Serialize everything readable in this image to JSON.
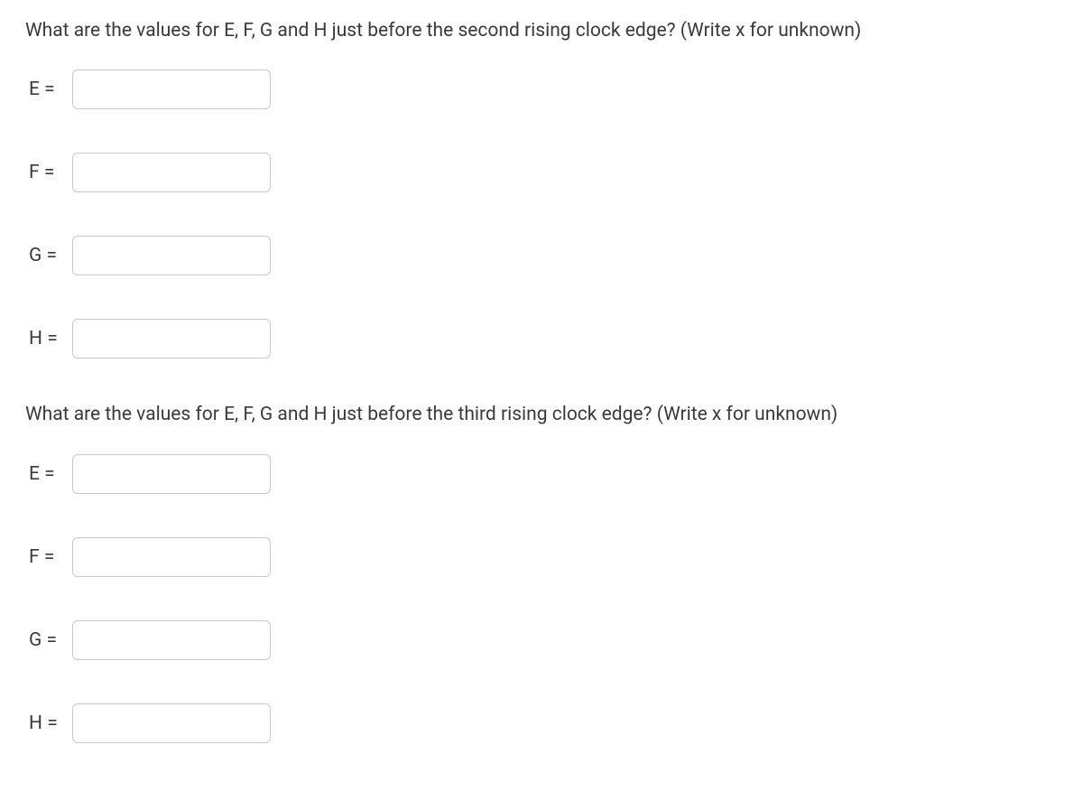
{
  "question1": {
    "text": "What are the values for E, F, G and H just before the second rising clock edge? (Write x for unknown)",
    "fields": [
      {
        "label": "E =",
        "value": ""
      },
      {
        "label": "F =",
        "value": ""
      },
      {
        "label": "G =",
        "value": ""
      },
      {
        "label": "H =",
        "value": ""
      }
    ]
  },
  "question2": {
    "text": "What are the values for E, F, G and H just before the third rising clock edge? (Write x for unknown)",
    "fields": [
      {
        "label": "E =",
        "value": ""
      },
      {
        "label": "F =",
        "value": ""
      },
      {
        "label": "G =",
        "value": ""
      },
      {
        "label": "H =",
        "value": ""
      }
    ]
  }
}
